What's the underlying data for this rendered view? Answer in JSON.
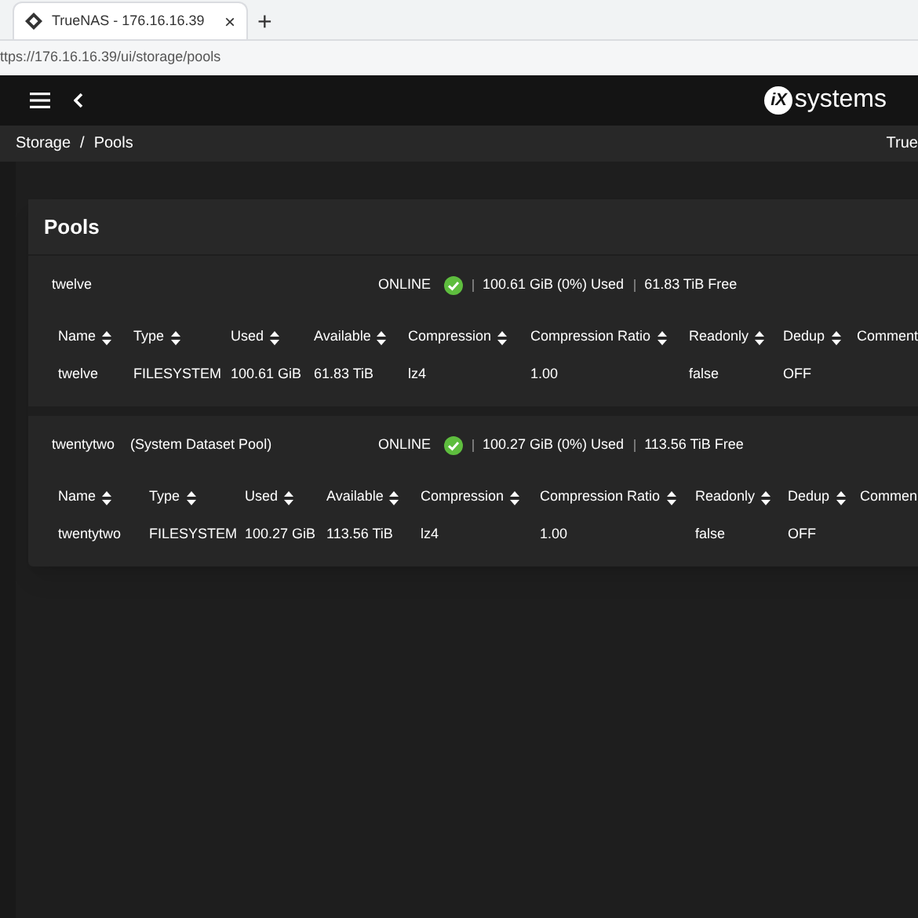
{
  "browser": {
    "tab": {
      "title": "TrueNAS - 176.16.16.39",
      "close": "×"
    },
    "new_tab": "+",
    "address": "ttps://176.16.16.39/ui/storage/pools"
  },
  "topbar": {
    "logo": {
      "mark": "iX",
      "text": "systems"
    }
  },
  "breadcrumb": {
    "items": [
      "Storage",
      "Pools"
    ],
    "separator": "/",
    "right": "True"
  },
  "card": {
    "title": "Pools",
    "pools": [
      {
        "name": "twelve",
        "status": "ONLINE",
        "used": "100.61 GiB (0%) Used",
        "free": "61.83 TiB Free",
        "columns": [
          "Name",
          "Type",
          "Used",
          "Available",
          "Compression",
          "Compression Ratio",
          "Readonly",
          "Dedup",
          "Comment"
        ],
        "row": [
          "twelve",
          "FILESYSTEM",
          "100.61 GiB",
          "61.83 TiB",
          "lz4",
          "1.00",
          "false",
          "OFF"
        ]
      },
      {
        "name": "twentytwo",
        "note": "(System Dataset Pool)",
        "status": "ONLINE",
        "used": "100.27 GiB (0%) Used",
        "free": "113.56 TiB Free",
        "columns": [
          "Name",
          "Type",
          "Used",
          "Available",
          "Compression",
          "Compression Ratio",
          "Readonly",
          "Dedup",
          "Commen"
        ],
        "row": [
          "twentytwo",
          "FILESYSTEM",
          "100.27 GiB",
          "113.56 TiB",
          "lz4",
          "1.00",
          "false",
          "OFF"
        ]
      }
    ]
  }
}
